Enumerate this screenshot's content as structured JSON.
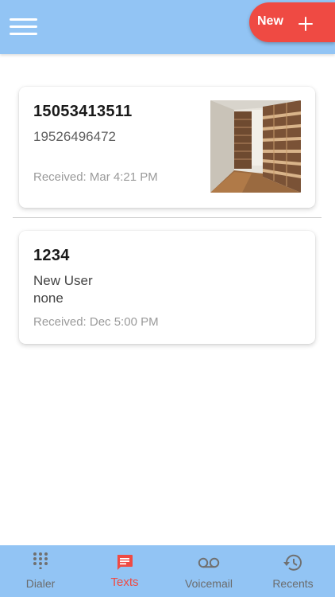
{
  "header": {
    "new_label": "New"
  },
  "messages": [
    {
      "from": "15053413511",
      "lines": [
        "19526496472"
      ],
      "received": "Received: Mar 4:21 PM",
      "has_image": true
    },
    {
      "from": "1234",
      "lines": [
        "New User",
        "none"
      ],
      "received": "Received: Dec 5:00 PM",
      "has_image": false
    }
  ],
  "bottom_nav": {
    "tabs": [
      {
        "label": "Dialer",
        "icon": "dialpad-icon",
        "active": false
      },
      {
        "label": "Texts",
        "icon": "message-icon",
        "active": true
      },
      {
        "label": "Voicemail",
        "icon": "voicemail-icon",
        "active": false
      },
      {
        "label": "Recents",
        "icon": "history-icon",
        "active": false
      }
    ]
  },
  "colors": {
    "bar": "#92c4f4",
    "accent": "#ef4a43",
    "inactive": "#6b6b6b"
  }
}
